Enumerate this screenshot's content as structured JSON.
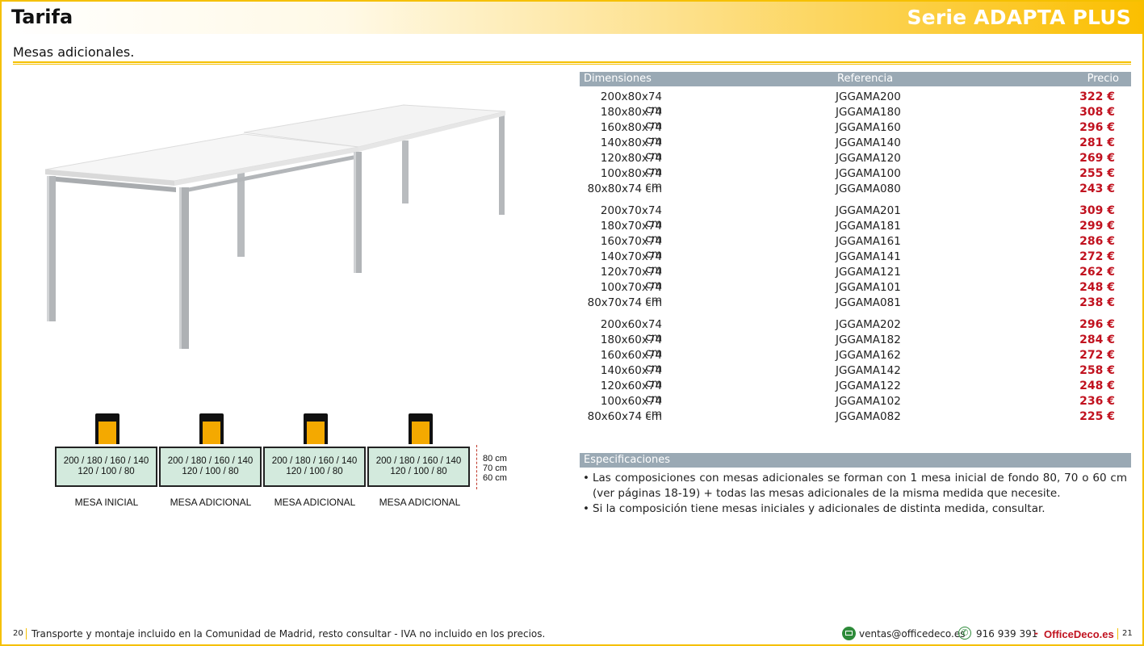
{
  "header": {
    "title": "Tarifa",
    "series": "Serie ADAPTA PLUS"
  },
  "subtitle": "Mesas adicionales.",
  "diagram": {
    "desks": [
      {
        "line1": "200 / 180 / 160 / 140",
        "line2": "120 / 100 / 80",
        "label": "MESA INICIAL"
      },
      {
        "line1": "200 / 180 / 160 / 140",
        "line2": "120 / 100 / 80",
        "label": "MESA ADICIONAL"
      },
      {
        "line1": "200 / 180 / 160 / 140",
        "line2": "120 / 100 / 80",
        "label": "MESA ADICIONAL"
      },
      {
        "line1": "200 / 180 / 160 / 140",
        "line2": "120 / 100 / 80",
        "label": "MESA ADICIONAL"
      }
    ],
    "depths": [
      "80 cm",
      "70 cm",
      "60 cm"
    ]
  },
  "price_table": {
    "headers": {
      "dim": "Dimensiones",
      "ref": "Referencia",
      "price": "Precio"
    },
    "rows": [
      {
        "dim": "200x80x74 cm",
        "ref": "JGGAMA200",
        "price": "322 €"
      },
      {
        "dim": "180x80x74 cm",
        "ref": "JGGAMA180",
        "price": "308 €"
      },
      {
        "dim": "160x80x74 cm",
        "ref": "JGGAMA160",
        "price": "296 €"
      },
      {
        "dim": "140x80x74 cm",
        "ref": "JGGAMA140",
        "price": "281 €"
      },
      {
        "dim": "120x80x74 cm",
        "ref": "JGGAMA120",
        "price": "269 €"
      },
      {
        "dim": "100x80x74 cm",
        "ref": "JGGAMA100",
        "price": "255 €"
      },
      {
        "dim": "80x80x74 cm",
        "ref": "JGGAMA080",
        "price": "243 €"
      },
      {
        "dim": "200x70x74 cm",
        "ref": "JGGAMA201",
        "price": "309 €"
      },
      {
        "dim": "180x70x74 cm",
        "ref": "JGGAMA181",
        "price": "299 €"
      },
      {
        "dim": "160x70x74 cm",
        "ref": "JGGAMA161",
        "price": "286 €"
      },
      {
        "dim": "140x70x74 cm",
        "ref": "JGGAMA141",
        "price": "272 €"
      },
      {
        "dim": "120x70x74 cm",
        "ref": "JGGAMA121",
        "price": "262 €"
      },
      {
        "dim": "100x70x74 cm",
        "ref": "JGGAMA101",
        "price": "248 €"
      },
      {
        "dim": "80x70x74 cm",
        "ref": "JGGAMA081",
        "price": "238 €"
      },
      {
        "dim": "200x60x74 cm",
        "ref": "JGGAMA202",
        "price": "296 €"
      },
      {
        "dim": "180x60x74 cm",
        "ref": "JGGAMA182",
        "price": "284 €"
      },
      {
        "dim": "160x60x74 cm",
        "ref": "JGGAMA162",
        "price": "272 €"
      },
      {
        "dim": "140x60x74 cm",
        "ref": "JGGAMA142",
        "price": "258 €"
      },
      {
        "dim": "120x60x74 cm",
        "ref": "JGGAMA122",
        "price": "248 €"
      },
      {
        "dim": "100x60x74 cm",
        "ref": "JGGAMA102",
        "price": "236 €"
      },
      {
        "dim": "80x60x74 cm",
        "ref": "JGGAMA082",
        "price": "225 €"
      }
    ]
  },
  "specs": {
    "heading": "Especificaciones",
    "items": [
      "Las composiciones con mesas adicionales se forman con 1 mesa inicial de fondo 80, 70 o 60 cm (ver páginas 18-19) + todas las mesas adicionales de la misma medida que necesite.",
      "Si la composición tiene mesas iniciales y adicionales de distinta medida, consultar."
    ]
  },
  "footer": {
    "page_left": "20",
    "note": "Transporte y montaje incluido en la Comunidad de Madrid, resto consultar - IVA no incluido en los precios.",
    "email": "ventas@officedeco.es",
    "phone": "916 939 391",
    "dash": "-",
    "brand": "OfficeDeco.es",
    "page_right": "21"
  },
  "colors": {
    "accent": "#f5c000",
    "price": "#c1121f",
    "table_header": "#9aa9b4",
    "desk_fill": "#d3eadd",
    "chair_cushion": "#f4a900"
  },
  "icons": [
    "email-icon",
    "phone-icon"
  ]
}
